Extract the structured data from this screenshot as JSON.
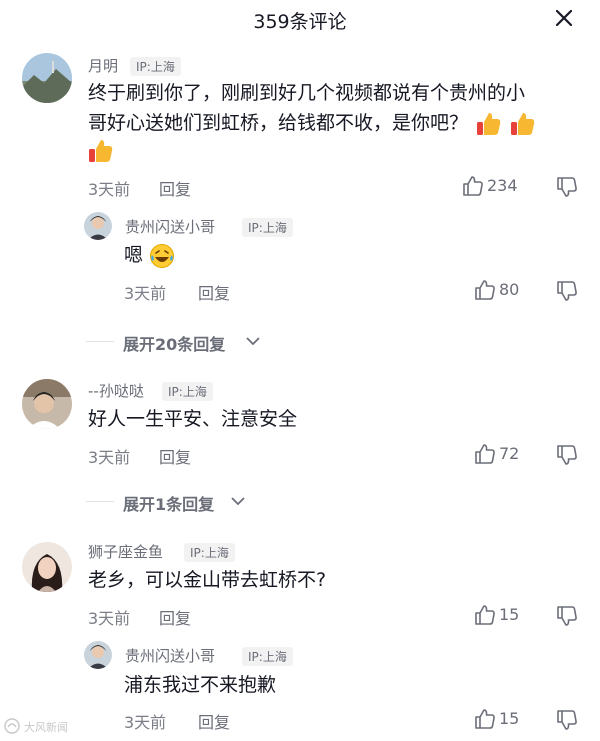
{
  "header": {
    "title": "359条评论"
  },
  "comments": [
    {
      "username": "月明",
      "ip": "IP:上海",
      "line1": "终于刷到你了，刚刷到好几个视频都说有个贵州的小",
      "line2": "哥好心送她们到虹桥，给钱都不收，是你吧？",
      "time": "3天前",
      "reply_label": "回复",
      "likes": "234",
      "emoji": "thumbs-up",
      "replies": [
        {
          "username": "贵州闪送小哥",
          "ip": "IP:上海",
          "text": "嗯",
          "time": "3天前",
          "reply_label": "回复",
          "likes": "80",
          "emoji": "laughing-tears"
        }
      ],
      "expand_label": "展开20条回复"
    },
    {
      "username": "--孙哒哒",
      "ip": "IP:上海",
      "text": "好人一生平安、注意安全",
      "time": "3天前",
      "reply_label": "回复",
      "likes": "72",
      "expand_label": "展开1条回复"
    },
    {
      "username": "狮子座金鱼",
      "ip": "IP:上海",
      "text": "老乡，可以金山带去虹桥不?",
      "time": "3天前",
      "reply_label": "回复",
      "likes": "15",
      "replies": [
        {
          "username": "贵州闪送小哥",
          "ip": "IP:上海",
          "text": "浦东我过不来抱歉",
          "time": "3天前",
          "reply_label": "回复",
          "likes": "15"
        }
      ]
    }
  ],
  "watermark": "大风新闻",
  "colors": {
    "text": "#161823",
    "secondary": "#6b6e78",
    "tag_bg": "#f2f2f3"
  }
}
